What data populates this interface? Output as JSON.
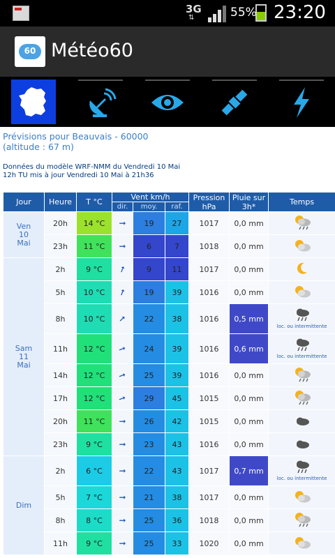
{
  "status_bar": {
    "network": "3G",
    "battery_pct": "55%",
    "time": "23:20"
  },
  "app": {
    "title": "Météo60"
  },
  "toolbar": {
    "items": [
      {
        "icon": "france-map-icon",
        "active": true
      },
      {
        "icon": "satellite-dish-icon",
        "active": false
      },
      {
        "icon": "eye-icon",
        "active": false
      },
      {
        "icon": "satellite-icon",
        "active": false
      },
      {
        "icon": "lightning-icon",
        "active": false
      }
    ]
  },
  "intro": {
    "title": "Prévisions pour Beauvais - 60000 (altitude : 67 m)",
    "model_line1": "Données du modèle WRF-NMM du Vendredi 10 Mai",
    "model_line2": "12h TU mis à jour Vendredi 10 Mai à 21h36"
  },
  "table": {
    "headers": {
      "jour": "Jour",
      "heure": "Heure",
      "temp": "T °C",
      "vent": "Vent km/h",
      "dir": "dir.",
      "moy": "moy.",
      "raf": "raf.",
      "pression_1": "Pression",
      "pression_2": "hPa",
      "pluie_1": "Pluie sur",
      "pluie_2": "3h*",
      "temps": "Temps"
    },
    "days": [
      {
        "label_1": "Ven",
        "label_2": "10",
        "label_3": "Mai",
        "rows": [
          {
            "hour": "20h",
            "temp": "14 °C",
            "temp_color": "#9be22c",
            "dir_rot": 0,
            "moy": "19",
            "moy_color": "#2c7ee0",
            "raf": "27",
            "raf_color": "#1ca6e8",
            "pressure": "1017",
            "rain": "0,0 mm",
            "rain_heavy": false,
            "weather_icon": "sun-cloud-rain-icon",
            "weather_label": ""
          },
          {
            "hour": "23h",
            "temp": "11 °C",
            "temp_color": "#3fe25a",
            "dir_rot": 0,
            "moy": "6",
            "moy_color": "#3346cc",
            "raf": "7",
            "raf_color": "#3346cc",
            "pressure": "1018",
            "rain": "0,0 mm",
            "rain_heavy": false,
            "weather_icon": "sun-cloud-icon",
            "weather_label": ""
          }
        ]
      },
      {
        "label_1": "Sam",
        "label_2": "11",
        "label_3": "Mai",
        "rows": [
          {
            "hour": "2h",
            "temp": "9 °C",
            "temp_color": "#1fe0a0",
            "dir_rot": -70,
            "moy": "9",
            "moy_color": "#3346cc",
            "raf": "11",
            "raf_color": "#3346cc",
            "pressure": "1017",
            "rain": "0,0 mm",
            "rain_heavy": false,
            "weather_icon": "moon-icon",
            "weather_label": ""
          },
          {
            "hour": "5h",
            "temp": "10 °C",
            "temp_color": "#20dcb4",
            "dir_rot": -70,
            "moy": "19",
            "moy_color": "#2c7ee0",
            "raf": "39",
            "raf_color": "#1cc2e6",
            "pressure": "1016",
            "rain": "0,0 mm",
            "rain_heavy": false,
            "weather_icon": "sun-cloud-icon",
            "weather_label": ""
          },
          {
            "hour": "8h",
            "temp": "10 °C",
            "temp_color": "#20dcb4",
            "dir_rot": -45,
            "moy": "22",
            "moy_color": "#248ce2",
            "raf": "38",
            "raf_color": "#1cc2e6",
            "pressure": "1016",
            "rain": "0,5 mm",
            "rain_heavy": true,
            "weather_icon": "cloud-rain-icon",
            "weather_label": "loc. ou intermittente"
          },
          {
            "hour": "11h",
            "temp": "12 °C",
            "temp_color": "#20e07a",
            "dir_rot": -20,
            "moy": "24",
            "moy_color": "#248ce2",
            "raf": "39",
            "raf_color": "#1cc2e6",
            "pressure": "1016",
            "rain": "0,6 mm",
            "rain_heavy": true,
            "weather_icon": "cloud-rain-icon",
            "weather_label": "loc. ou intermittente"
          },
          {
            "hour": "14h",
            "temp": "12 °C",
            "temp_color": "#20e07a",
            "dir_rot": -20,
            "moy": "25",
            "moy_color": "#248ce2",
            "raf": "39",
            "raf_color": "#1cc2e6",
            "pressure": "1016",
            "rain": "0,0 mm",
            "rain_heavy": false,
            "weather_icon": "sun-cloud-rain-icon",
            "weather_label": ""
          },
          {
            "hour": "17h",
            "temp": "12 °C",
            "temp_color": "#20e07a",
            "dir_rot": -20,
            "moy": "29",
            "moy_color": "#2c7ee0",
            "raf": "45",
            "raf_color": "#1cc2e6",
            "pressure": "1015",
            "rain": "0,0 mm",
            "rain_heavy": false,
            "weather_icon": "sun-cloud-rain-icon",
            "weather_label": ""
          },
          {
            "hour": "20h",
            "temp": "11 °C",
            "temp_color": "#3fe25a",
            "dir_rot": 0,
            "moy": "26",
            "moy_color": "#248ce2",
            "raf": "42",
            "raf_color": "#1cc2e6",
            "pressure": "1015",
            "rain": "0,0 mm",
            "rain_heavy": false,
            "weather_icon": "cloud-icon",
            "weather_label": ""
          },
          {
            "hour": "23h",
            "temp": "9 °C",
            "temp_color": "#1fe0a0",
            "dir_rot": 0,
            "moy": "23",
            "moy_color": "#248ce2",
            "raf": "43",
            "raf_color": "#1cc2e6",
            "pressure": "1016",
            "rain": "0,0 mm",
            "rain_heavy": false,
            "weather_icon": "cloud-icon",
            "weather_label": ""
          }
        ]
      },
      {
        "label_1": "Dim",
        "label_2": "",
        "label_3": "",
        "rows": [
          {
            "hour": "2h",
            "temp": "6 °C",
            "temp_color": "#1ccce6",
            "dir_rot": 0,
            "moy": "22",
            "moy_color": "#248ce2",
            "raf": "43",
            "raf_color": "#1cc2e6",
            "pressure": "1017",
            "rain": "0,7 mm",
            "rain_heavy": true,
            "weather_icon": "cloud-rain-icon",
            "weather_label": "loc. ou intermittente"
          },
          {
            "hour": "5h",
            "temp": "7 °C",
            "temp_color": "#1cd8d8",
            "dir_rot": 0,
            "moy": "21",
            "moy_color": "#248ce2",
            "raf": "38",
            "raf_color": "#1cc2e6",
            "pressure": "1017",
            "rain": "0,0 mm",
            "rain_heavy": false,
            "weather_icon": "sun-cloud-icon",
            "weather_label": ""
          },
          {
            "hour": "8h",
            "temp": "8 °C",
            "temp_color": "#1cdcc8",
            "dir_rot": 0,
            "moy": "25",
            "moy_color": "#248ce2",
            "raf": "36",
            "raf_color": "#1cc2e6",
            "pressure": "1018",
            "rain": "0,0 mm",
            "rain_heavy": false,
            "weather_icon": "sun-cloud-rain-icon",
            "weather_label": ""
          },
          {
            "hour": "11h",
            "temp": "9 °C",
            "temp_color": "#1fe0a0",
            "dir_rot": 0,
            "moy": "25",
            "moy_color": "#248ce2",
            "raf": "33",
            "raf_color": "#1cc2e6",
            "pressure": "1020",
            "rain": "0,0 mm",
            "rain_heavy": false,
            "weather_icon": "sun-cloud-icon",
            "weather_label": ""
          }
        ]
      }
    ]
  }
}
